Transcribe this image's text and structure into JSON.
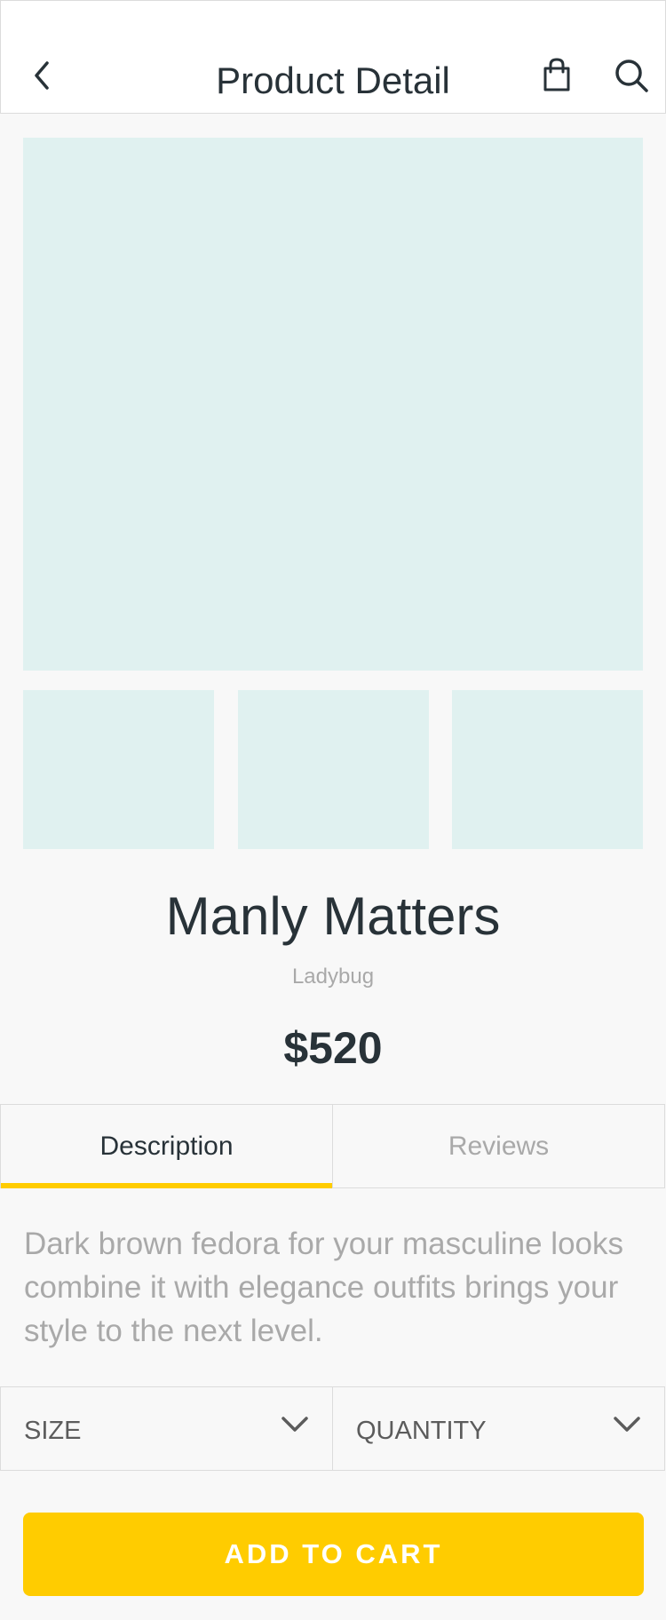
{
  "header": {
    "title": "Product Detail",
    "icons": [
      "chevron-left-icon",
      "shopping-bag-icon",
      "search-icon"
    ]
  },
  "product": {
    "name": "Manly Matters",
    "brand": "Ladybug",
    "price": "$520",
    "image_count": 3
  },
  "tabs": [
    {
      "label": "Description",
      "active": true
    },
    {
      "label": "Reviews",
      "active": false
    }
  ],
  "description": "Dark brown fedora for your masculine looks combine it with elegance outfits brings your style to the next level.",
  "selectors": {
    "size_label": "SIZE",
    "quantity_label": "QUANTITY"
  },
  "cart": {
    "label": "ADD TO CART"
  },
  "colors": {
    "accent": "#ffcc00",
    "text_dark": "#283238",
    "text_muted": "#a9a9a9",
    "image_placeholder": "#e0f1f0",
    "background": "#f8f8f8"
  }
}
